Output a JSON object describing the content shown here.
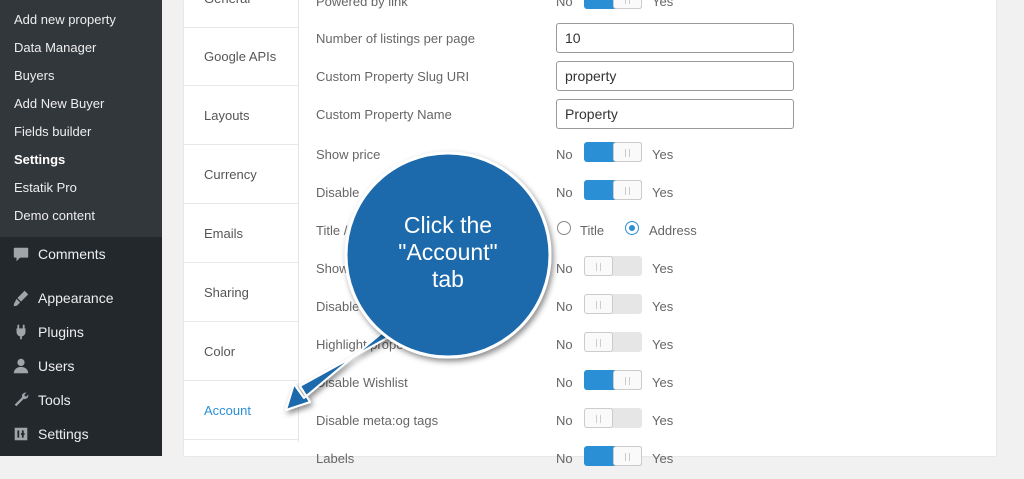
{
  "sidebar": {
    "submenu": [
      "Add new property",
      "Data Manager",
      "Buyers",
      "Add New Buyer",
      "Fields builder",
      "Settings",
      "Estatik Pro",
      "Demo content"
    ],
    "current_submenu": "Settings",
    "menu": [
      {
        "label": "Comments",
        "icon": "comments-icon"
      },
      {
        "label": "Appearance",
        "icon": "appearance-icon"
      },
      {
        "label": "Plugins",
        "icon": "plugins-icon"
      },
      {
        "label": "Users",
        "icon": "users-icon"
      },
      {
        "label": "Tools",
        "icon": "tools-icon"
      },
      {
        "label": "Settings",
        "icon": "settings-icon"
      }
    ]
  },
  "tabs": [
    {
      "label": "General"
    },
    {
      "label": "Google APIs"
    },
    {
      "label": "Layouts"
    },
    {
      "label": "Currency"
    },
    {
      "label": "Emails"
    },
    {
      "label": "Sharing"
    },
    {
      "label": "Color"
    },
    {
      "label": "Account"
    }
  ],
  "active_tab": "Account",
  "toggle_labels": {
    "no": "No",
    "yes": "Yes"
  },
  "settings": {
    "powered_by": {
      "label": "Powered by link",
      "on": true
    },
    "listings_per_page": {
      "label": "Number of listings per page",
      "value": "10"
    },
    "slug_uri": {
      "label": "Custom Property Slug URI",
      "value": "property"
    },
    "property_name": {
      "label": "Custom Property Name",
      "value": "Property"
    },
    "show_price": {
      "label": "Show price",
      "on": true
    },
    "disable_1": {
      "label": "Disable",
      "on": true
    },
    "title_address": {
      "label": "Title /",
      "options": [
        "Title",
        "Address"
      ],
      "selected": "Address"
    },
    "show_2": {
      "label": "Show",
      "on": false
    },
    "disable_3": {
      "label": "Disable",
      "on": false
    },
    "highlight": {
      "label": "Highlight property",
      "on": false
    },
    "wishlist": {
      "label": "Disable Wishlist",
      "on": true
    },
    "meta_og": {
      "label": "Disable meta:og tags",
      "on": false
    },
    "labels": {
      "label": "Labels",
      "on": true
    }
  },
  "callout": {
    "line1": "Click the",
    "line2": "\"Account\"",
    "line3": "tab",
    "color": "#1e6bab"
  },
  "colors": {
    "accent": "#2b8fd5",
    "sidebar": "#23282d",
    "submenu": "#32373c"
  }
}
